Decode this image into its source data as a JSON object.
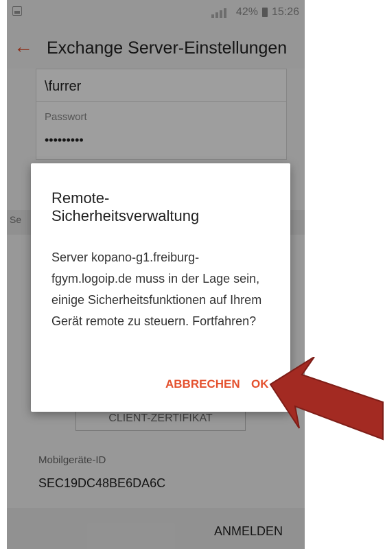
{
  "status_bar": {
    "battery": "42%",
    "time": "15:26"
  },
  "header": {
    "back_icon": "arrow-left-icon",
    "title": "Exchange Server-Einstellungen"
  },
  "form": {
    "username_value": "\\furrer",
    "password_label": "Passwort",
    "password_value": "•••••••••",
    "section_label": "Se",
    "client_cert_button": "CLIENT-ZERTIFIKAT",
    "device_id_label": "Mobilgeräte-ID",
    "device_id_value": "SEC19DC48BE6DA6C",
    "signin_button": "ANMELDEN"
  },
  "dialog": {
    "title": "Remote-\nSicherheitsverwaltung",
    "message": "Server kopano-g1.freiburg-fgym.logoip.de muss in der Lage sein, einige Sicherheitsfunktionen auf Ihrem Gerät remote zu steuern. Fortfahren?",
    "cancel_label": "ABBRECHEN",
    "ok_label": "OK"
  },
  "colors": {
    "accent": "#e4512e",
    "annotation_arrow": "#a32a22"
  }
}
